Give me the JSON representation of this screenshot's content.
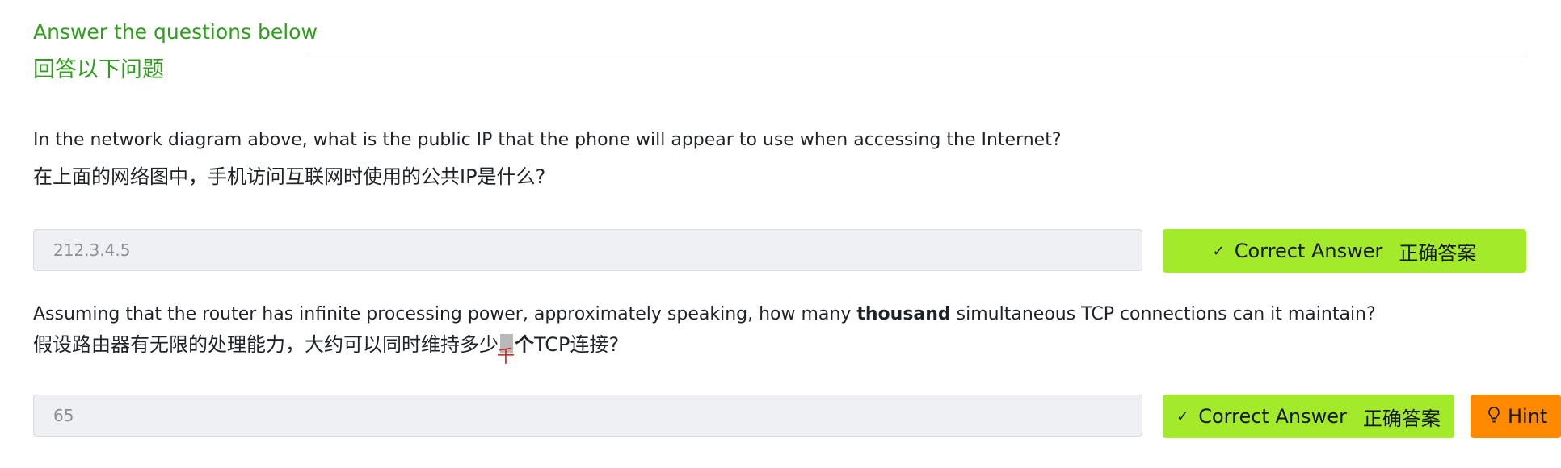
{
  "header": {
    "title_en": "Answer the questions below",
    "title_zh": "回答以下问题"
  },
  "questions": [
    {
      "text_en": "In the network diagram above, what is the public IP that the phone will appear to use when accessing the Internet?",
      "text_zh": "在上面的网络图中，手机访问互联网时使用的公共IP是什么?",
      "answer_value": "212.3.4.5",
      "correct_label_en": "Correct Answer",
      "correct_label_zh": "正确答案",
      "correct_icon": "check-icon"
    },
    {
      "text_en_before": "Assuming that the router has infinite processing power, approximately speaking, how many ",
      "text_en_bold": "thousand",
      "text_en_after": " simultaneous TCP connections can it maintain?",
      "text_zh_before": "假设路由器有无限的处理能力，大约可以同时维持多少",
      "text_zh_bold": "个",
      "text_zh_after": "TCP连接?",
      "annotation_zh": "千",
      "answer_value": "65",
      "correct_label_en": "Correct Answer",
      "correct_label_zh": "正确答案",
      "correct_icon": "check-icon",
      "hint_label": "Hint",
      "hint_icon": "lightbulb-icon"
    }
  ],
  "colors": {
    "accent_green_text": "#2e9f1b",
    "correct_button": "#a3ea2a",
    "hint_button": "#ff8a00",
    "input_bg": "#eef0f3",
    "annotation_red": "#e0261f"
  }
}
